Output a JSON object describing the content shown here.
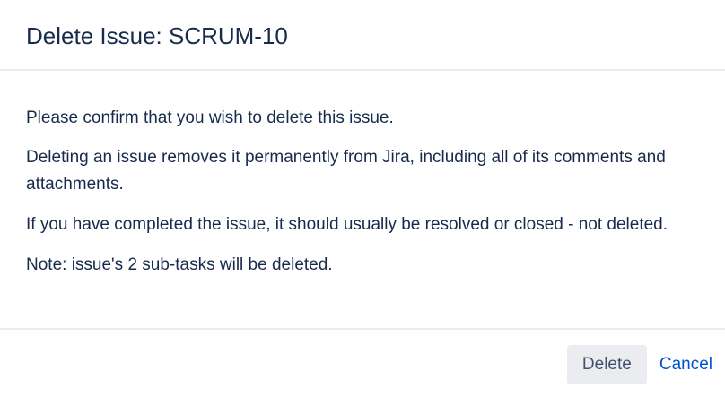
{
  "dialog": {
    "title": "Delete Issue: SCRUM-10",
    "paragraphs": [
      "Please confirm that you wish to delete this issue.",
      "Deleting an issue removes it permanently from Jira, including all of its comments and attachments.",
      "If you have completed the issue, it should usually be resolved or closed - not deleted.",
      "Note: issue's 2 sub-tasks will be deleted."
    ],
    "buttons": {
      "delete_label": "Delete",
      "cancel_label": "Cancel"
    }
  },
  "colors": {
    "text": "#172b4d",
    "divider": "#ebecf0",
    "delete_button_bg": "#ebecf0",
    "link": "#0052cc"
  }
}
